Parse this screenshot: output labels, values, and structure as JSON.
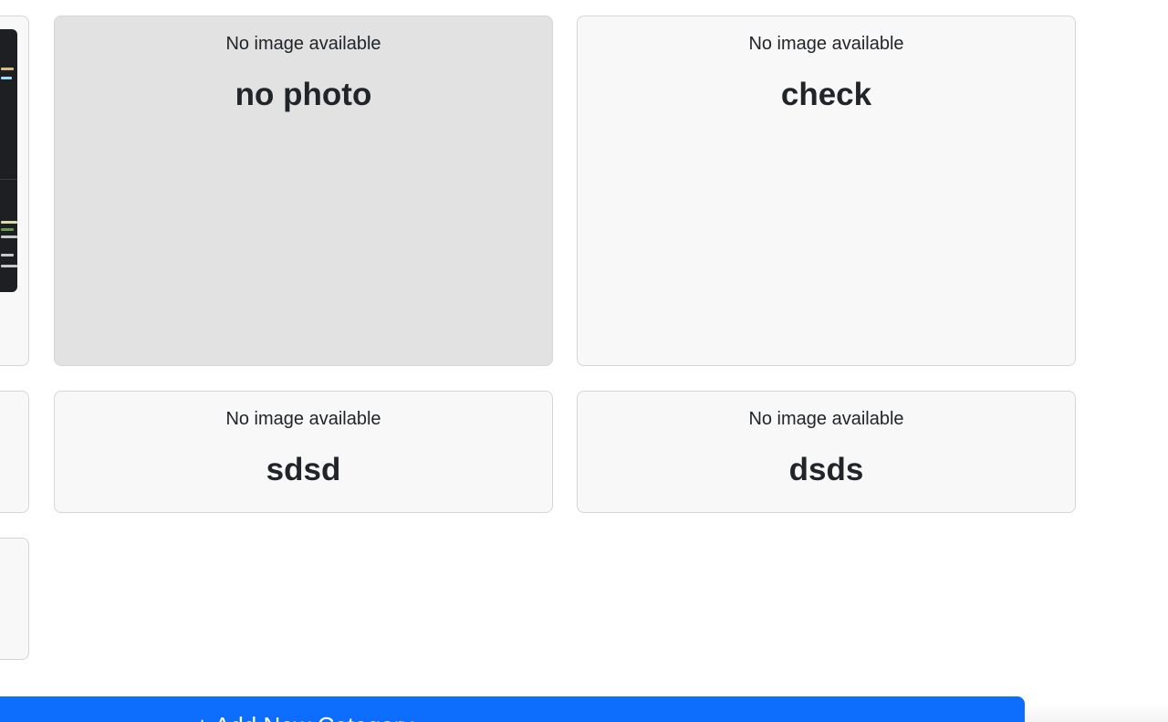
{
  "categories": [
    {
      "no_image_text": "No image available",
      "name": "no photo",
      "hovered": true
    },
    {
      "no_image_text": "No image available",
      "name": "check",
      "hovered": false
    },
    {
      "no_image_text": "No image available",
      "name": "sdsd",
      "hovered": false
    },
    {
      "no_image_text": "No image available",
      "name": "dsds",
      "hovered": false
    }
  ],
  "add_button": {
    "label": "+ Add New Category"
  },
  "colors": {
    "card_background": "#f8f8f8",
    "card_hover_background": "#e2e2e2",
    "card_border": "#d6d6d6",
    "primary_button": "#0d6efd",
    "code_thumbnail_background": "#1e1f22"
  }
}
